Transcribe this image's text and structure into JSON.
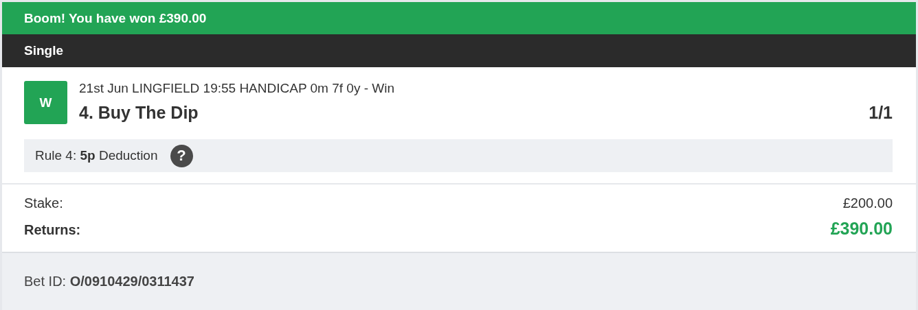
{
  "banner": {
    "text": "Boom! You have won £390.00"
  },
  "bet_type": "Single",
  "selection": {
    "result_badge": "W",
    "event": "21st Jun LINGFIELD 19:55 HANDICAP 0m 7f 0y - Win",
    "name": "4. Buy The Dip",
    "odds": "1/1"
  },
  "rule4": {
    "text": "Rule 4: **5p** Deduction",
    "help_icon": "?"
  },
  "totals": [
    {
      "label": "Stake:",
      "value": "£200.00",
      "kind": "stake"
    },
    {
      "label": "Returns:",
      "value": "£390.00",
      "kind": "returns"
    }
  ],
  "footer": {
    "text": "Bet ID: **O/0910429/0311437**"
  }
}
